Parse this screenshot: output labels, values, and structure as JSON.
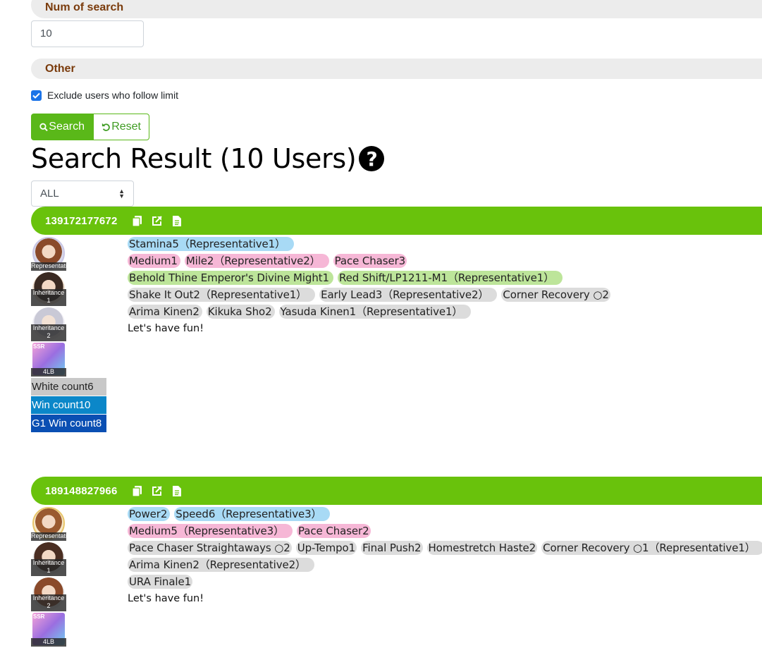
{
  "form": {
    "num_of_search_label": "Num of search",
    "num_of_search_value": "10",
    "other_label": "Other",
    "exclude_label": "Exclude users who follow limit",
    "search_label": "Search",
    "reset_label": "Reset"
  },
  "result": {
    "title": "Search Result (10 Users)",
    "help_glyph": "?",
    "filter_value": "ALL"
  },
  "colors": {
    "header_green": "#69c20c",
    "button_green": "#5ab819",
    "tag_blue": "#a8daf5",
    "tag_pink": "#f6b7d6",
    "tag_green": "#bde59a",
    "tag_gray": "#dcdcdc"
  },
  "icons": [
    "search-icon",
    "undo-icon",
    "question-circle-icon",
    "copy-icon",
    "external-link-icon",
    "document-icon",
    "sort-arrows-icon",
    "check-icon"
  ],
  "users": [
    {
      "id": "139172177672",
      "avatars": [
        {
          "caption": "Representati",
          "type": "rep"
        },
        {
          "caption1": "Inheritance",
          "caption2": "1",
          "type": "inh"
        },
        {
          "caption1": "Inheritance",
          "caption2": "2",
          "type": "inh"
        },
        {
          "caption": "4LB",
          "badge": "SSR",
          "type": "card"
        }
      ],
      "white_count": "White count6",
      "win_count": "Win count10",
      "g1_win_count": "G1 Win count8",
      "rows": [
        [
          {
            "text": "Stamina5（Representative1）",
            "color": "blue"
          }
        ],
        [
          {
            "text": "Medium1",
            "color": "pink"
          },
          {
            "text": "Mile2（Representative2）",
            "color": "pink"
          },
          {
            "text": "Pace Chaser3",
            "color": "pink"
          }
        ],
        [
          {
            "text": "Behold Thine Emperor's Divine Might1",
            "color": "green"
          },
          {
            "text": "Red Shift/LP1211-M1（Representative1）",
            "color": "green"
          }
        ],
        [
          {
            "text": "Shake It Out2（Representative1）",
            "color": "gray"
          },
          {
            "text": "Early Lead3（Representative2）",
            "color": "gray"
          },
          {
            "text": "Corner Recovery ○2",
            "color": "gray"
          }
        ],
        [
          {
            "text": "Arima Kinen2",
            "color": "gray"
          },
          {
            "text": "Kikuka Sho2",
            "color": "gray"
          },
          {
            "text": "Yasuda Kinen1（Representative1）",
            "color": "gray"
          }
        ]
      ],
      "comment": "Let's have fun!"
    },
    {
      "id": "189148827966",
      "avatars": [
        {
          "caption": "Representati",
          "type": "rep"
        },
        {
          "caption1": "Inheritance",
          "caption2": "1",
          "type": "inh"
        },
        {
          "caption1": "Inheritance",
          "caption2": "2",
          "type": "inh"
        },
        {
          "caption": "4LB",
          "badge": "SSR",
          "type": "card"
        }
      ],
      "rows": [
        [
          {
            "text": "Power2",
            "color": "blue"
          },
          {
            "text": "Speed6（Representative3）",
            "color": "blue"
          }
        ],
        [
          {
            "text": "Medium5（Representative3）",
            "color": "pink"
          },
          {
            "text": "Pace Chaser2",
            "color": "pink"
          }
        ],
        [
          {
            "text": "Pace Chaser Straightaways ○2",
            "color": "gray"
          },
          {
            "text": "Up-Tempo1",
            "color": "gray"
          },
          {
            "text": "Final Push2",
            "color": "gray"
          },
          {
            "text": "Homestretch Haste2",
            "color": "gray"
          },
          {
            "text": "Corner Recovery ○1（Representative1）",
            "color": "gray"
          }
        ],
        [
          {
            "text": "Arima Kinen2（Representative2）",
            "color": "gray"
          }
        ],
        [
          {
            "text": "URA Finale1",
            "color": "gray"
          }
        ]
      ],
      "comment": "Let's have fun!"
    }
  ]
}
